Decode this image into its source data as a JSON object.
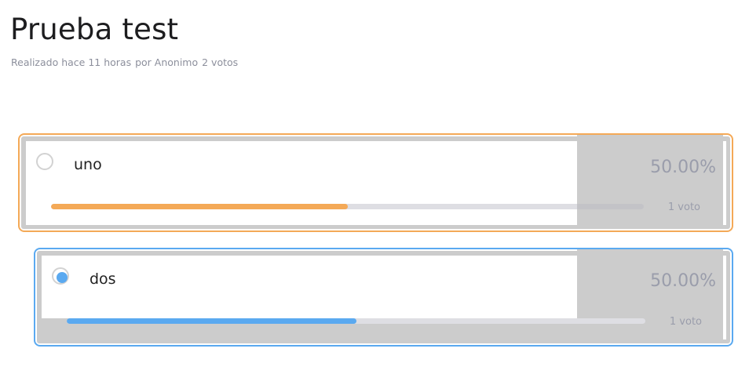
{
  "poll": {
    "title": "Prueba test",
    "meta": {
      "realizado": "Realizado hace 11 horas",
      "autor": "por Anonimo",
      "total_votos": "2 votos"
    }
  },
  "options": [
    {
      "label": "uno",
      "percent_text": "50.00%",
      "votes_text": "1 voto",
      "fraction": 0.5,
      "selected": false,
      "accent": "#f4a957"
    },
    {
      "label": "dos",
      "percent_text": "50.00%",
      "votes_text": "1 voto",
      "fraction": 0.5,
      "selected": true,
      "accent": "#5aa9f0"
    }
  ]
}
